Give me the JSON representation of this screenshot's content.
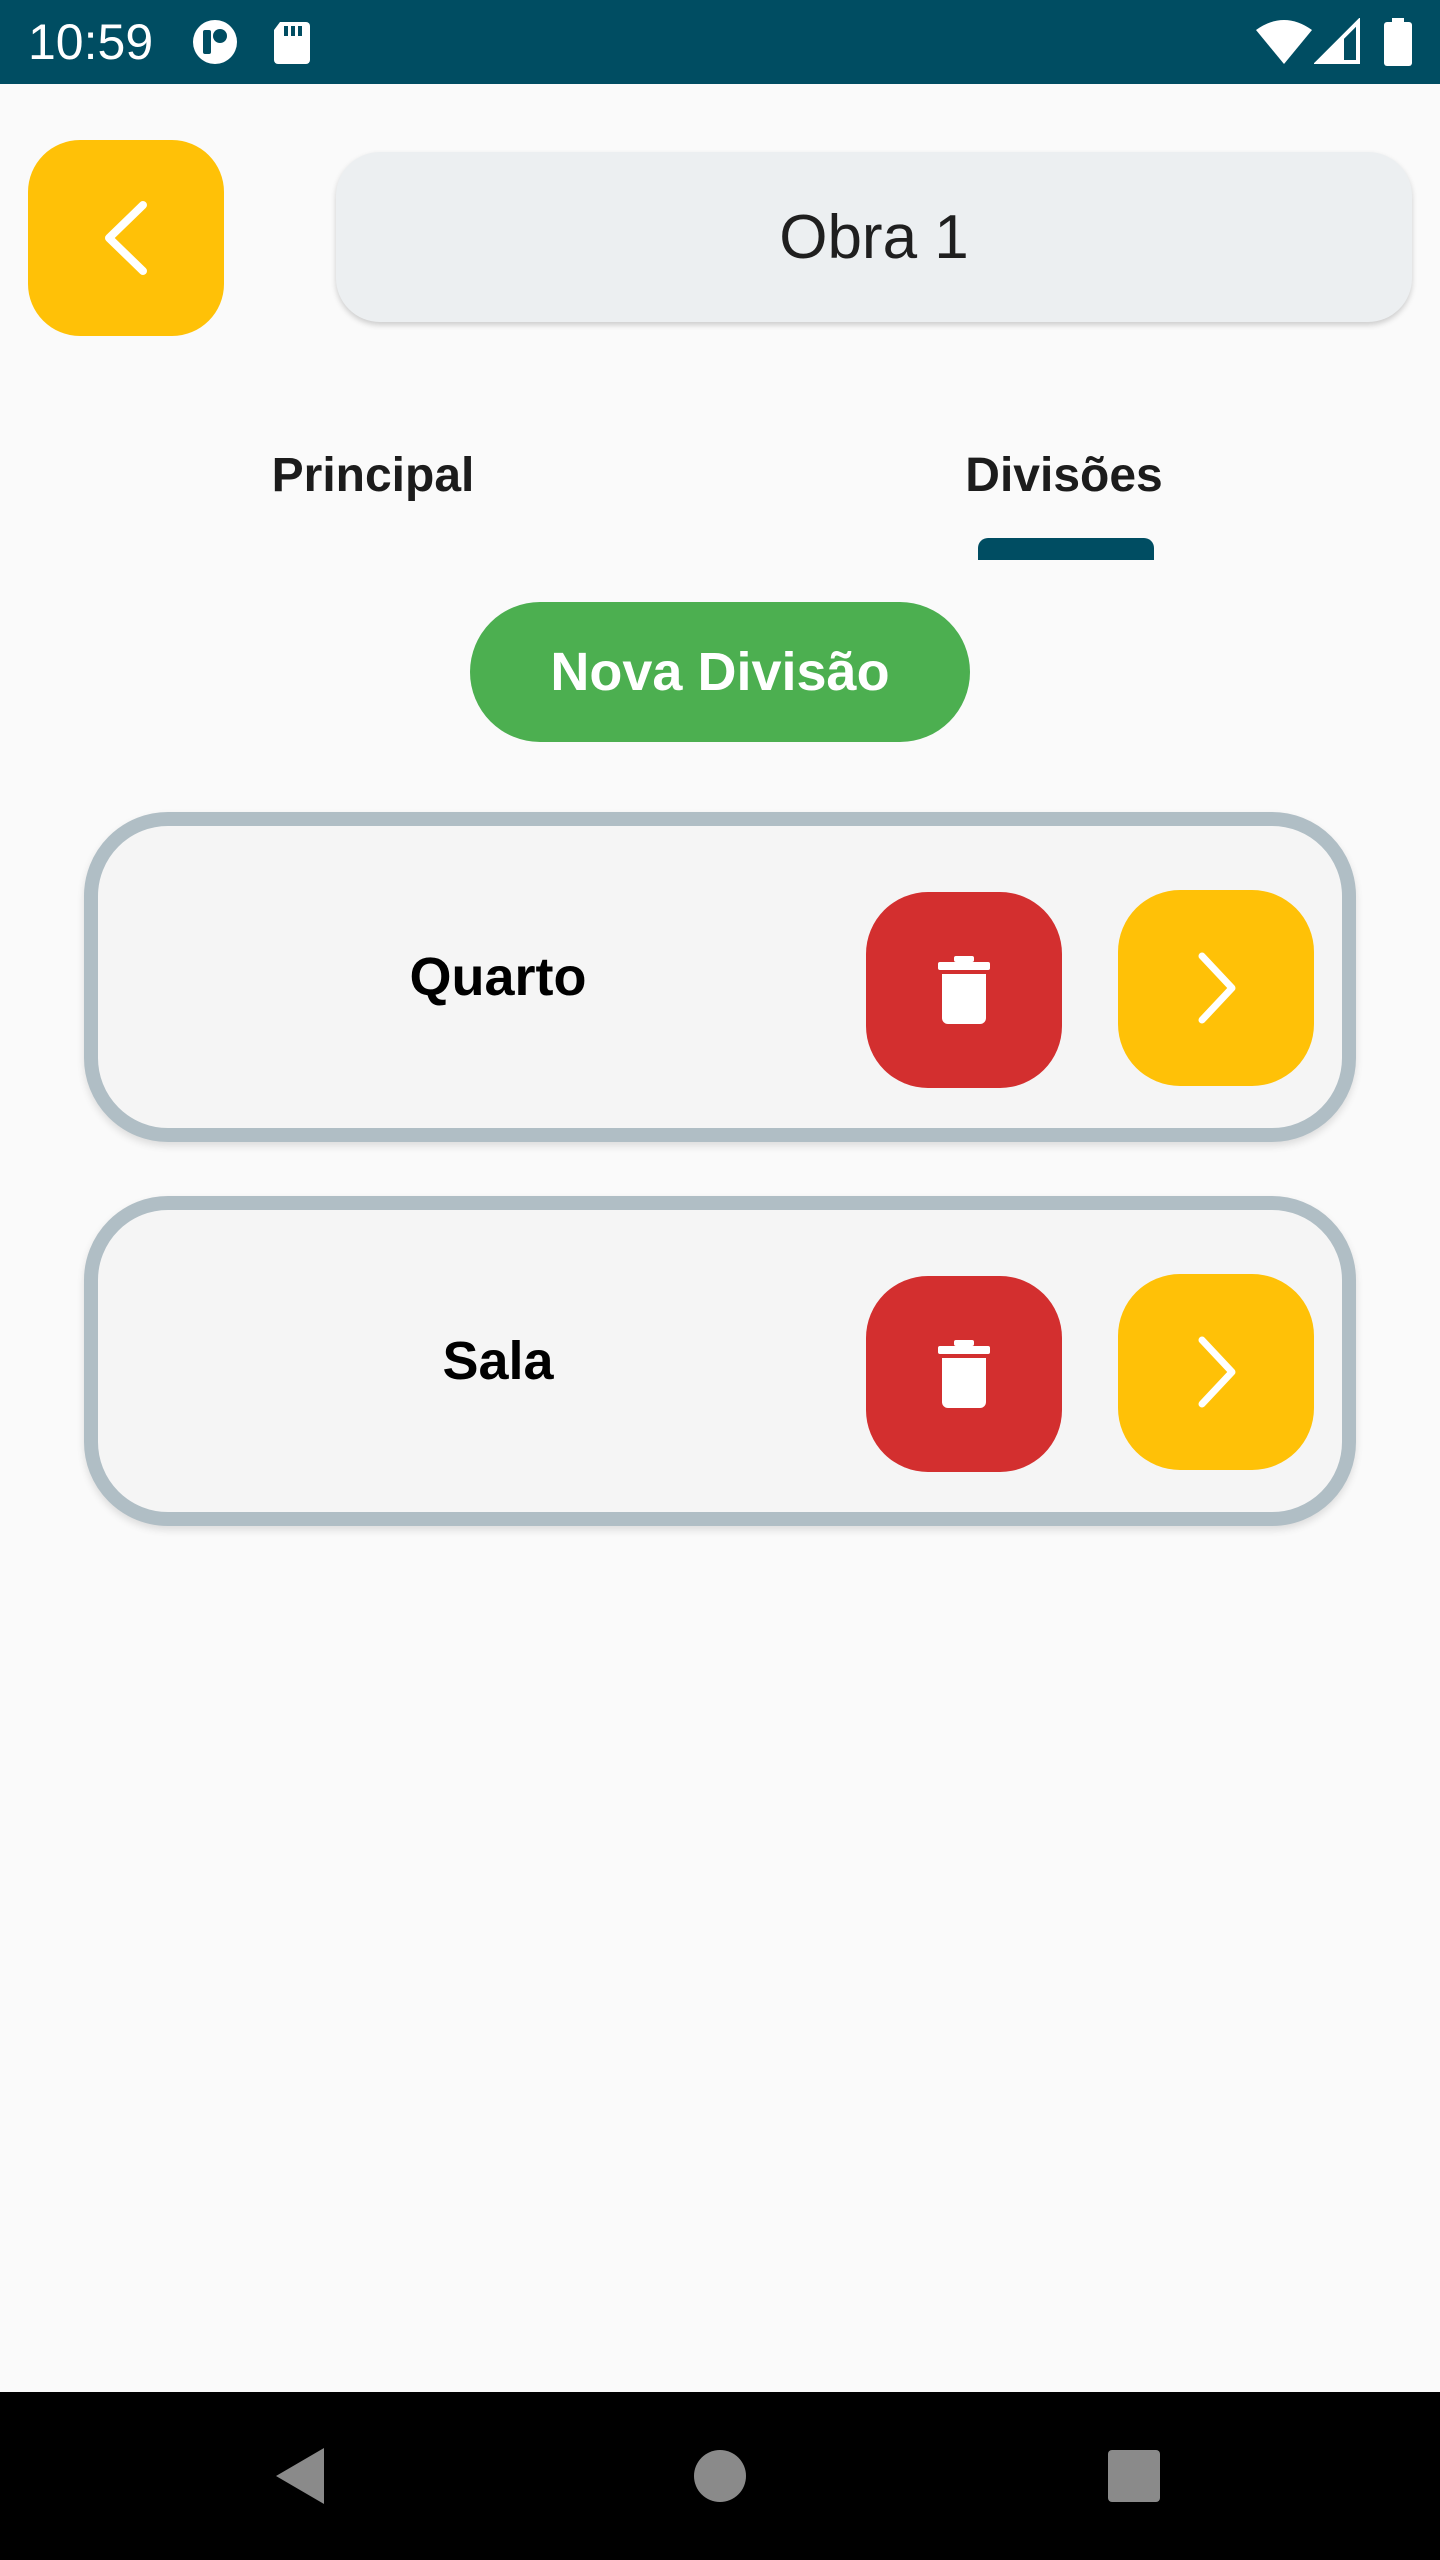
{
  "status_bar": {
    "time": "10:59",
    "icons": [
      "app-notification-icon",
      "sd-card-icon",
      "wifi-icon",
      "signal-icon",
      "battery-icon"
    ],
    "background": "#004d62"
  },
  "header": {
    "title": "Obra 1",
    "back_icon": "chevron-left-icon"
  },
  "tabs": [
    {
      "label": "Principal",
      "selected": false
    },
    {
      "label": "Divisões",
      "selected": true
    }
  ],
  "actions": {
    "new_division_label": "Nova Divisão"
  },
  "divisions": [
    {
      "name": "Quarto"
    },
    {
      "name": "Sala"
    }
  ],
  "colors": {
    "accent_yellow": "#ffc107",
    "delete_red": "#d32f2f",
    "primary_green": "#4caf50",
    "card_border": "#b0bec5",
    "tab_indicator": "#004d62"
  },
  "nav_bar": {
    "buttons": [
      "back-triangle-icon",
      "home-circle-icon",
      "recents-square-icon"
    ]
  }
}
